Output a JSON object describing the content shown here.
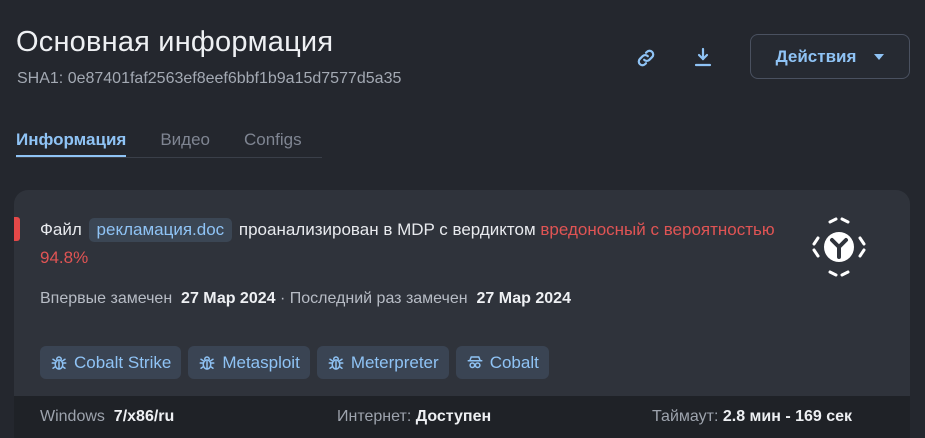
{
  "header": {
    "title": "Основная информация",
    "sha_label": "SHA1: 0e87401faf2563ef8eef6bbf1b9a15d7577d5a35",
    "actions_label": "Действия",
    "icons": [
      "link-icon",
      "download-icon"
    ]
  },
  "tabs": [
    {
      "label": "Информация",
      "active": true
    },
    {
      "label": "Видео",
      "active": false
    },
    {
      "label": "Configs",
      "active": false
    }
  ],
  "verdict": {
    "prefix": "Файл",
    "file_name": "рекламация.doc",
    "middle": "проанализирован в MDP с вердиктом",
    "verdict_text": "вредоносный с вероятностью 94.8%"
  },
  "seen": {
    "first_label": "Впервые замечен",
    "first_date": "27 Мар 2024",
    "separator": "·",
    "last_label": "Последний раз замечен",
    "last_date": "27 Мар 2024"
  },
  "tags": [
    {
      "label": "Cobalt Strike",
      "icon": "bug-icon"
    },
    {
      "label": "Metasploit",
      "icon": "bug-icon"
    },
    {
      "label": "Meterpreter",
      "icon": "bug-icon"
    },
    {
      "label": "Cobalt",
      "icon": "spy-icon"
    }
  ],
  "footer": {
    "os_label": "Windows",
    "os_value": "7/x86/ru",
    "internet_label": "Интернет:",
    "internet_value": "Доступен",
    "timeout_label": "Таймаут:",
    "timeout_value": "2.8 мин - 169 сек"
  },
  "colors": {
    "background": "#24272e",
    "card": "#2f333b",
    "accent": "#8fc3f5",
    "danger": "#e05454",
    "footer": "#1f2227"
  }
}
